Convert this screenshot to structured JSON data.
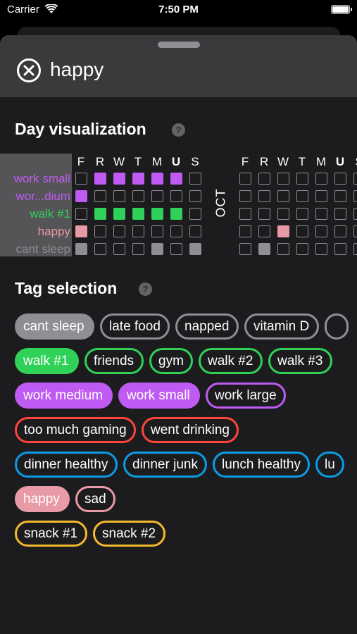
{
  "status": {
    "carrier": "Carrier",
    "time": "7:50 PM"
  },
  "header": {
    "title": "happy"
  },
  "viz": {
    "title": "Day visualization",
    "help": "?",
    "month": "OCT",
    "days_a": [
      "F",
      "R",
      "W",
      "T",
      "M",
      "U",
      "S"
    ],
    "days_b": [
      "F",
      "R",
      "W",
      "T",
      "M",
      "U",
      "S"
    ],
    "bold_day_index": 5,
    "rows": [
      {
        "label": "work small",
        "color": "#bf5af2",
        "a": [
          0,
          1,
          1,
          1,
          1,
          1,
          0
        ],
        "b": [
          0,
          0,
          0,
          0,
          0,
          0,
          0
        ]
      },
      {
        "label": "wor...dium",
        "color": "#bf5af2",
        "a": [
          1,
          0,
          0,
          0,
          0,
          0,
          0
        ],
        "b": [
          0,
          0,
          0,
          0,
          0,
          0,
          0
        ]
      },
      {
        "label": "walk #1",
        "color": "#30d158",
        "a": [
          0,
          1,
          1,
          1,
          1,
          1,
          0
        ],
        "b": [
          0,
          0,
          0,
          0,
          0,
          0,
          0
        ]
      },
      {
        "label": "happy",
        "color": "#e89aa6",
        "a": [
          1,
          0,
          0,
          0,
          0,
          0,
          0
        ],
        "b": [
          0,
          0,
          1,
          0,
          0,
          0,
          0
        ]
      },
      {
        "label": "cant sleep",
        "color": "#8e8e93",
        "a": [
          1,
          0,
          0,
          0,
          1,
          0,
          1
        ],
        "b": [
          0,
          1,
          0,
          0,
          0,
          0,
          0
        ]
      }
    ]
  },
  "tags": {
    "title": "Tag selection",
    "help": "?",
    "rows": [
      [
        {
          "label": "cant sleep",
          "color": "#8e8e93",
          "filled": true
        },
        {
          "label": "late food",
          "color": "#8e8e93",
          "filled": false
        },
        {
          "label": "napped",
          "color": "#8e8e93",
          "filled": false
        },
        {
          "label": "vitamin D",
          "color": "#8e8e93",
          "filled": false
        },
        {
          "label": "",
          "color": "#8e8e93",
          "filled": false
        }
      ],
      [
        {
          "label": "walk #1",
          "color": "#30d158",
          "filled": true
        },
        {
          "label": "friends",
          "color": "#30d158",
          "filled": false
        },
        {
          "label": "gym",
          "color": "#30d158",
          "filled": false
        },
        {
          "label": "walk #2",
          "color": "#30d158",
          "filled": false
        },
        {
          "label": "walk #3",
          "color": "#30d158",
          "filled": false
        }
      ],
      [
        {
          "label": "work medium",
          "color": "#bf5af2",
          "filled": true
        },
        {
          "label": "work small",
          "color": "#bf5af2",
          "filled": true
        },
        {
          "label": "work large",
          "color": "#bf5af2",
          "filled": false
        }
      ],
      [
        {
          "label": "too much gaming",
          "color": "#ff453a",
          "filled": false
        },
        {
          "label": "went drinking",
          "color": "#ff453a",
          "filled": false
        }
      ],
      [
        {
          "label": "dinner healthy",
          "color": "#0a9ce6",
          "filled": false
        },
        {
          "label": "dinner junk",
          "color": "#0a9ce6",
          "filled": false
        },
        {
          "label": "lunch healthy",
          "color": "#0a9ce6",
          "filled": false
        },
        {
          "label": "lu",
          "color": "#0a9ce6",
          "filled": false
        }
      ],
      [
        {
          "label": "happy",
          "color": "#e89aa6",
          "filled": true
        },
        {
          "label": "sad",
          "color": "#e89aa6",
          "filled": false
        }
      ],
      [
        {
          "label": "snack #1",
          "color": "#f5b82e",
          "filled": false
        },
        {
          "label": "snack #2",
          "color": "#f5b82e",
          "filled": false
        }
      ]
    ]
  }
}
